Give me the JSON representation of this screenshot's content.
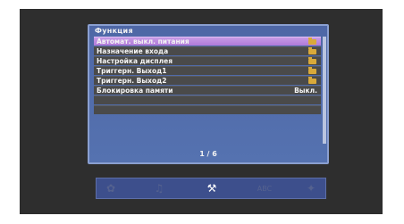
{
  "menu": {
    "title": "Функция",
    "items": [
      {
        "label": "Автомат. выкл. питания",
        "value": "",
        "icon": "folder-icon",
        "selected": true
      },
      {
        "label": "Назначение входа",
        "value": "",
        "icon": "folder-icon"
      },
      {
        "label": "Настройка дисплея",
        "value": "",
        "icon": "folder-icon"
      },
      {
        "label": "Триггерн. Выход1",
        "value": "",
        "icon": "folder-icon"
      },
      {
        "label": "Триггерн. Выход2",
        "value": "",
        "icon": "folder-icon"
      },
      {
        "label": "Блокировка памяти",
        "value": "Выкл.",
        "icon": ""
      },
      {
        "label": "",
        "value": ""
      },
      {
        "label": "",
        "value": ""
      }
    ],
    "page_indicator": "1 / 6"
  },
  "toolbar": {
    "items": [
      {
        "name": "picture-icon",
        "glyph": "✿",
        "active": false
      },
      {
        "name": "sound-icon",
        "glyph": "♫",
        "active": false
      },
      {
        "name": "wrench-icon",
        "glyph": "⚒",
        "active": true
      },
      {
        "name": "language-icon",
        "glyph": "ABC",
        "active": false
      },
      {
        "name": "info-icon",
        "glyph": "✦",
        "active": false
      }
    ]
  },
  "colors": {
    "panel": "#5270ae",
    "selected_row": "#b889dd",
    "row": "#4a4a4a",
    "folder": "#d9a93a"
  }
}
